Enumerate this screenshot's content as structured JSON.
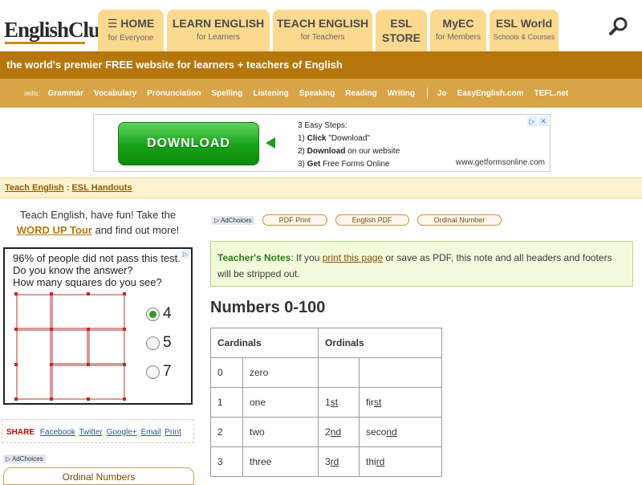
{
  "header": {
    "logo": "EnglishClub",
    "tabs": [
      {
        "title": "HOME",
        "subtitle": "for Everyone",
        "width": 82
      },
      {
        "title": "LEARN ENGLISH",
        "subtitle": "for Learners",
        "width": 128
      },
      {
        "title": "TEACH ENGLISH",
        "subtitle": "for Teachers",
        "width": 124
      },
      {
        "title": "ESL",
        "subtitle": "STORE",
        "width": 64
      },
      {
        "title": "MyEC",
        "subtitle": "for Members",
        "width": 70
      },
      {
        "title": "ESL World",
        "subtitle": "Schools & Courses",
        "width": 86
      }
    ],
    "search_icon": "search-icon"
  },
  "tagline": "the world's premier FREE website for learners + teachers of English",
  "skills": {
    "label": "skills:",
    "items": [
      "Grammar",
      "Vocabulary",
      "Pronunciation",
      "Spelling",
      "Listening",
      "Speaking",
      "Reading",
      "Writing"
    ],
    "extra": [
      "Jo",
      "EasyEnglish.com",
      "TEFL.net"
    ]
  },
  "ad": {
    "button": "DOWNLOAD",
    "steps_title": "3 Easy Steps:",
    "step1_pre": "1) ",
    "step1_bold": "Click",
    "step1_post": " \"Download\"",
    "step2_pre": "2) ",
    "step2_bold": "Download",
    "step2_post": " on our website",
    "step3_pre": "3) ",
    "step3_bold": "Get",
    "step3_post": " Free Forms Online",
    "url": "www.getformsonline.com"
  },
  "breadcrumb": {
    "item1": "Teach English",
    "sep": " : ",
    "item2": "ESL Handouts"
  },
  "left": {
    "promo_line1": "Teach English, have fun! Take the",
    "promo_link": "WORD UP Tour",
    "promo_line2": " and find out more!",
    "quiz_q1": "96% of people did not pass this test.",
    "quiz_q2": "Do you know the answer?",
    "quiz_q3": "How many squares do you see?",
    "options": [
      "4",
      "5",
      "7"
    ],
    "share_label": "SHARE",
    "share_links": [
      "Facebook",
      "Twitter",
      "Google+",
      "Email",
      "Print"
    ],
    "adchoices": "AdChoices",
    "ordinal_button": "Ordinal Numbers"
  },
  "right": {
    "adchoices": "AdChoices",
    "buttons": [
      "PDF Print",
      "English PDF",
      "Ordinal Number"
    ],
    "notes_title": "Teacher's Notes",
    "notes_pre": ": If you ",
    "notes_link": "print this page",
    "notes_post": " or save as PDF, this note and all headers and footers will be stripped out.",
    "title": "Numbers 0-100",
    "table": {
      "headers": [
        "Cardinals",
        "Ordinals"
      ],
      "rows": [
        {
          "n": "0",
          "word": "zero",
          "ord_num": "",
          "ord_suf": "",
          "ord_word": "",
          "ord_word_suf": ""
        },
        {
          "n": "1",
          "word": "one",
          "ord_num": "1",
          "ord_suf": "st",
          "ord_word": "fir",
          "ord_word_suf": "st"
        },
        {
          "n": "2",
          "word": "two",
          "ord_num": "2",
          "ord_suf": "nd",
          "ord_word": "seco",
          "ord_word_suf": "nd"
        },
        {
          "n": "3",
          "word": "three",
          "ord_num": "3",
          "ord_suf": "rd",
          "ord_word": "thi",
          "ord_word_suf": "rd"
        }
      ]
    }
  }
}
